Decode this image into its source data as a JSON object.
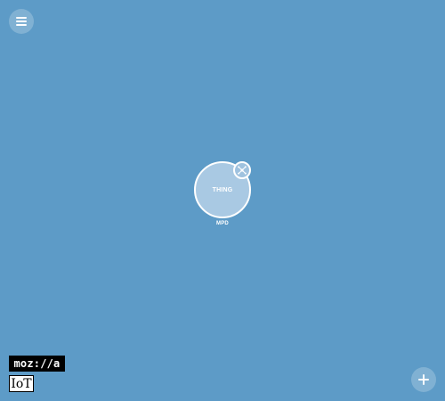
{
  "header": {
    "menu_icon": "menu-icon"
  },
  "things": [
    {
      "label": "THING",
      "name": "MPD",
      "badge_icon": "network-icon"
    }
  ],
  "branding": {
    "mozilla_text": "moz://a",
    "iot_text": "IoT"
  },
  "footer": {
    "add_icon": "plus-icon"
  },
  "colors": {
    "background": "#5d9bc7",
    "thing_fill": "#a9c9e3",
    "white": "#ffffff",
    "black": "#000000"
  }
}
